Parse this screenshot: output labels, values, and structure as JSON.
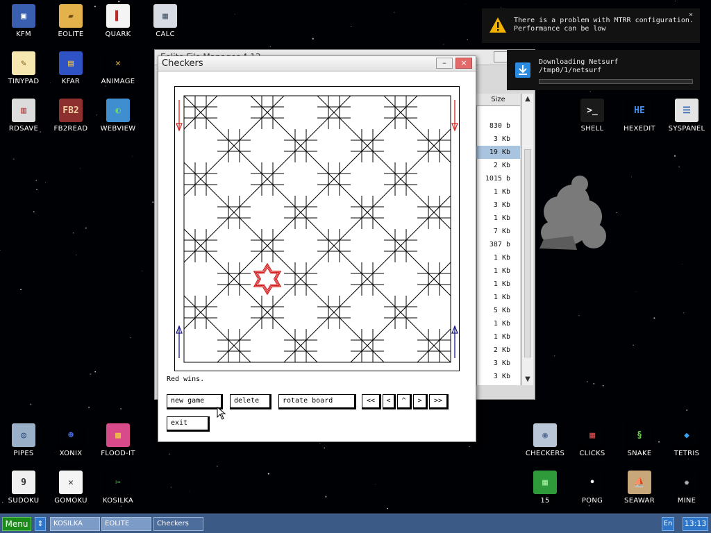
{
  "desktop_icons_left": [
    {
      "name": "icon-kfm",
      "label": "KFM",
      "glyph": "▣",
      "bg": "#3a5fb0",
      "fg": "#ffffff"
    },
    {
      "name": "icon-eolite",
      "label": "EOLITE",
      "glyph": "▰",
      "bg": "#e3b24a",
      "fg": "#6b4b10"
    },
    {
      "name": "icon-quark",
      "label": "QUARK",
      "glyph": "▌",
      "bg": "#f4f4f4",
      "fg": "#c02828"
    },
    {
      "name": "icon-calc",
      "label": "CALC",
      "glyph": "▦",
      "bg": "#d7dbe3",
      "fg": "#4a5670"
    },
    {
      "name": "icon-tinypad",
      "label": "TINYPAD",
      "glyph": "✎",
      "bg": "#f6e7b0",
      "fg": "#7a5a10"
    },
    {
      "name": "icon-kfar",
      "label": "KFAR",
      "glyph": "▤",
      "bg": "#2f52c4",
      "fg": "#ffcc33"
    },
    {
      "name": "icon-animage",
      "label": "ANIMAGE",
      "glyph": "✕",
      "bg": "#000104",
      "fg": "#e8b74a"
    },
    {
      "name": "icon-rdsave",
      "label": "RDSAVE",
      "glyph": "▥",
      "bg": "#dcdcdc",
      "fg": "#b03030"
    },
    {
      "name": "icon-fb2read",
      "label": "FB2READ",
      "glyph": "FB2",
      "bg": "#8e2f2f",
      "fg": "#f0d0a0"
    },
    {
      "name": "icon-webview",
      "label": "WEBVIEW",
      "glyph": "◐",
      "bg": "#3f8fd0",
      "fg": "#6ad06a"
    },
    {
      "name": "icon-pipes",
      "label": "PIPES",
      "glyph": "◎",
      "bg": "#9ab0c8",
      "fg": "#2f4f7f"
    },
    {
      "name": "icon-xonix",
      "label": "XONIX",
      "glyph": "☻",
      "bg": "#000104",
      "fg": "#4a6ae0"
    },
    {
      "name": "icon-flood-it",
      "label": "FLOOD-IT",
      "glyph": "▩",
      "bg": "#d84a8a",
      "fg": "#f0d040"
    },
    {
      "name": "icon-sudoku",
      "label": "SUDOKU",
      "glyph": "9",
      "bg": "#f0f0f0",
      "fg": "#303030"
    },
    {
      "name": "icon-gomoku",
      "label": "GOMOKU",
      "glyph": "✕",
      "bg": "#f4f4f4",
      "fg": "#333333"
    },
    {
      "name": "icon-kosilka",
      "label": "KOSILKA",
      "glyph": "✂",
      "bg": "#000104",
      "fg": "#52b052"
    }
  ],
  "desktop_icons_right": [
    {
      "name": "icon-shell",
      "label": "SHELL",
      "glyph": ">_",
      "bg": "#1a1a1a",
      "fg": "#f0f0f0"
    },
    {
      "name": "icon-hexedit",
      "label": "HEXEDIT",
      "glyph": "HE",
      "bg": "#000104",
      "fg": "#3d8ef0"
    },
    {
      "name": "icon-syspanel",
      "label": "SYSPANEL",
      "glyph": "☰",
      "bg": "#e4e4e4",
      "fg": "#3a6ab0"
    },
    {
      "name": "icon-checkers",
      "label": "CHECKERS",
      "glyph": "◉",
      "bg": "#b8c6d8",
      "fg": "#526a90"
    },
    {
      "name": "icon-clicks",
      "label": "CLICKS",
      "glyph": "▦",
      "bg": "#000104",
      "fg": "#e05050"
    },
    {
      "name": "icon-snake",
      "label": "SNAKE",
      "glyph": "§",
      "bg": "#000104",
      "fg": "#6ad04a"
    },
    {
      "name": "icon-tetris",
      "label": "TETRIS",
      "glyph": "◆",
      "bg": "#000104",
      "fg": "#3aa0f0"
    },
    {
      "name": "icon-15",
      "label": "15",
      "glyph": "▦",
      "bg": "#2f9a3a",
      "fg": "#a0f0a0"
    },
    {
      "name": "icon-pong",
      "label": "PONG",
      "glyph": "•",
      "bg": "#000104",
      "fg": "#f0f0f0"
    },
    {
      "name": "icon-seawar",
      "label": "SEAWAR",
      "glyph": "⛵",
      "bg": "#c8a87a",
      "fg": "#503010"
    },
    {
      "name": "icon-mine",
      "label": "MINE",
      "glyph": "✹",
      "bg": "#000104",
      "fg": "#b0b0b0"
    }
  ],
  "bg_window": {
    "title": "Eolite File Manager 4.13",
    "size_header": "Size",
    "sizes": [
      "830 b",
      "3 Kb",
      "19 Kb",
      "2 Kb",
      "1015 b",
      "1 Kb",
      "3 Kb",
      "1 Kb",
      "7 Kb",
      "387 b",
      "1 Kb",
      "1 Kb",
      "1 Kb",
      "1 Kb",
      "5 Kb",
      "1 Kb",
      "1 Kb",
      "2 Kb",
      "3 Kb",
      "3 Kb"
    ],
    "selected_index": 2
  },
  "checkers": {
    "title": "Checkers",
    "status": "Red wins.",
    "buttons": {
      "new_game": "new game",
      "delete": "delete",
      "rotate": "rotate board",
      "first": "<<",
      "prev": "<",
      "up": "^",
      "next": ">",
      "last": ">>",
      "exit": "exit"
    },
    "board": {
      "rows": 8,
      "cols": 8,
      "red_piece": {
        "row": 5,
        "col": 2
      },
      "red_color": "#d42020",
      "blue_color": "#1a1a8c"
    }
  },
  "notifications": {
    "mtrr_line1": "There is a problem with MTRR configuration.",
    "mtrr_line2": "Performance can be low",
    "download_line1": "Downloading Netsurf",
    "download_line2": "/tmp0/1/netsurf",
    "download_progress": 0.0
  },
  "taskbar": {
    "menu": "Menu",
    "switch": "⇕",
    "tasks": [
      "KOSILKA",
      "EOLITE",
      "Checkers"
    ],
    "active_task": 2,
    "lang": "En",
    "clock": "13:13"
  },
  "colors": {
    "taskbar": "#3c5a86",
    "menu_green": "#1b8a1b",
    "selection": "#a9c4de"
  }
}
